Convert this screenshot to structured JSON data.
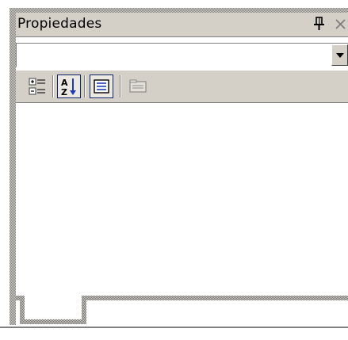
{
  "window": {
    "title": "Propiedades"
  },
  "title_bar": {
    "pin_icon": "pushpin-icon",
    "close_icon": "close-icon"
  },
  "object_selector": {
    "value": ""
  },
  "toolbar": {
    "buttons": [
      {
        "icon": "categorized-icon",
        "pressed": false
      },
      {
        "icon": "sort-alphabetical-icon",
        "pressed": true
      },
      {
        "icon": "properties-icon",
        "pressed": true
      },
      {
        "icon": "property-pages-icon",
        "pressed": false,
        "disabled": true
      }
    ]
  },
  "colors": {
    "chrome": "#d4d0c8",
    "pressed_border": "#0a246a",
    "shadow": "#808080"
  }
}
